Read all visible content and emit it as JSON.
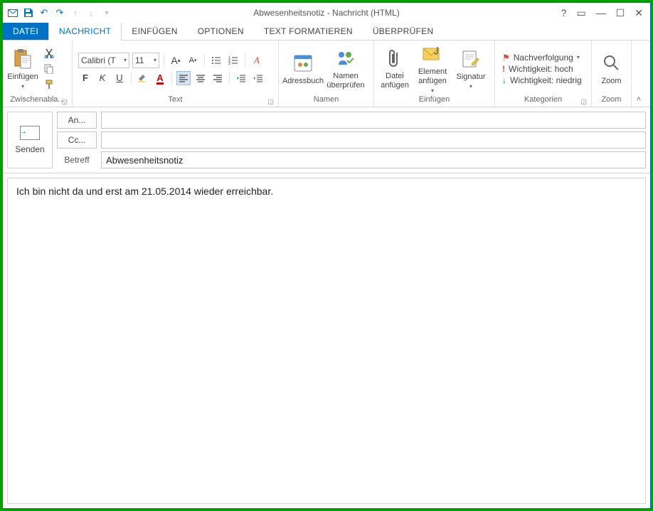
{
  "window_title": "Abwesenheitsnotiz - Nachricht (HTML)",
  "qat": {
    "envelope": "✉",
    "save": "💾",
    "undo": "↶",
    "redo": "↷",
    "up": "↑",
    "down": "↓",
    "more": "≡"
  },
  "tabs": {
    "file": "DATEI",
    "message": "NACHRICHT",
    "insert": "EINFÜGEN",
    "options": "OPTIONEN",
    "format": "TEXT FORMATIEREN",
    "review": "ÜBERPRÜFEN"
  },
  "ribbon": {
    "clipboard": {
      "label": "Zwischenabla...",
      "paste": "Einfügen"
    },
    "text": {
      "label": "Text",
      "font": "Calibri (T",
      "size": "11",
      "bold": "F",
      "italic": "K",
      "underline": "U"
    },
    "names": {
      "label": "Namen",
      "addressbook": "Adressbuch",
      "checknames": "Namen überprüfen"
    },
    "include": {
      "label": "Einfügen",
      "attachfile": "Datei anfügen",
      "attachitem": "Element anfügen",
      "signature": "Signatur"
    },
    "tags": {
      "label": "Kategorien",
      "followup": "Nachverfolgung",
      "highimp": "Wichtigkeit: hoch",
      "lowimp": "Wichtigkeit: niedrig"
    },
    "zoom": {
      "label": "Zoom",
      "btn": "Zoom"
    }
  },
  "compose": {
    "send": "Senden",
    "to": "An...",
    "cc": "Cc...",
    "subject_label": "Betreff",
    "subject_value": "Abwesenheitsnotiz"
  },
  "body_text": "Ich bin nicht da und erst am 21.05.2014 wieder erreichbar."
}
